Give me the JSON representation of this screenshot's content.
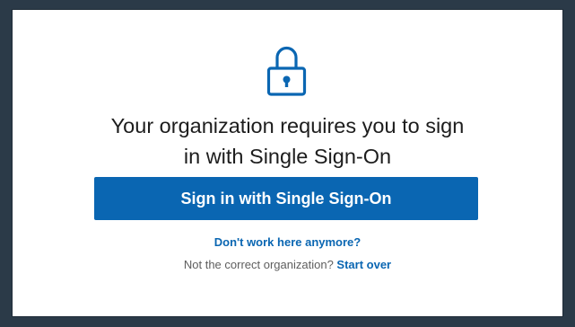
{
  "heading": {
    "line1": "Your organization requires you to sign",
    "line2": "in with Single Sign-On"
  },
  "icons": {
    "lock": "lock-icon"
  },
  "primary_button": {
    "label": "Sign in with Single Sign-On"
  },
  "links": {
    "leave_org": "Don't work here anymore?",
    "wrong_org_prompt": "Not the correct organization?",
    "start_over": "Start over"
  },
  "colors": {
    "accent": "#0a66b2",
    "frame": "#2b3a48",
    "text": "#1d1d1d",
    "muted_text": "#5e5e5e"
  }
}
